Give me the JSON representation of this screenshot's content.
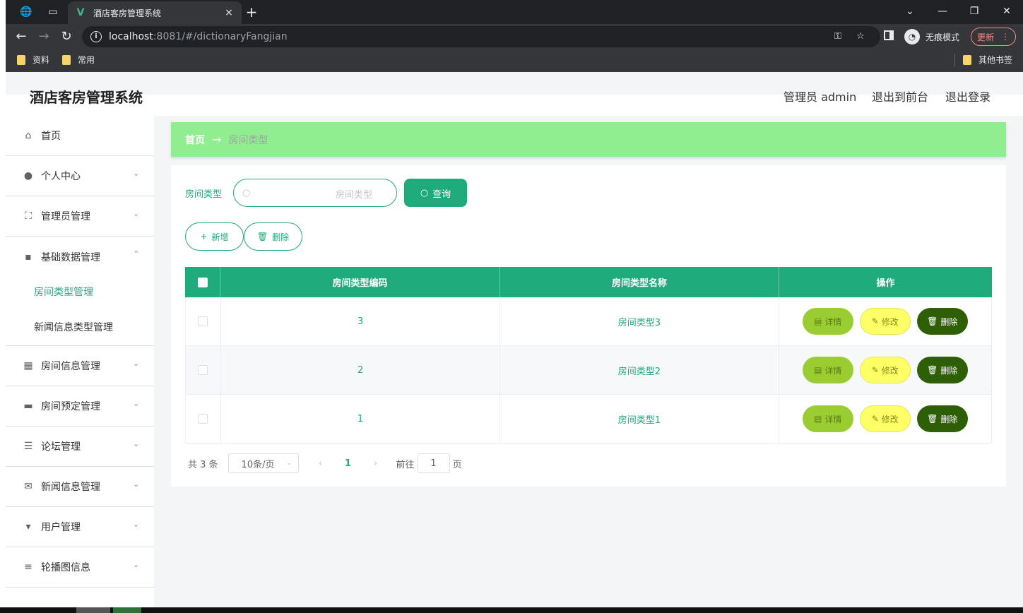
{
  "browser": {
    "tab_title": "酒店客房管理系统",
    "tab_close": "×",
    "new_tab": "+",
    "url_host": "localhost",
    "url_rest": ":8081/#/dictionaryFangjian",
    "incognito_label": "无痕模式",
    "update_label": "更新",
    "bookmarks": [
      "资料",
      "常用"
    ],
    "other_bookmarks": "其他书签"
  },
  "header": {
    "title": "酒店客房管理系统",
    "admin_label": "管理员 admin",
    "to_front": "退出到前台",
    "logout": "退出登录"
  },
  "sidebar": {
    "items": [
      {
        "label": "首页",
        "icon": "home-icon",
        "expandable": false
      },
      {
        "label": "个人中心",
        "icon": "user-icon",
        "expandable": true
      },
      {
        "label": "管理员管理",
        "icon": "fullscreen-icon",
        "expandable": true
      },
      {
        "label": "基础数据管理",
        "icon": "chat-icon",
        "expandable": true,
        "expanded": true
      },
      {
        "label": "房间信息管理",
        "icon": "grid-icon",
        "expandable": true
      },
      {
        "label": "房间预定管理",
        "icon": "briefcase-icon",
        "expandable": true
      },
      {
        "label": "论坛管理",
        "icon": "sliders-icon",
        "expandable": true
      },
      {
        "label": "新闻信息管理",
        "icon": "mail-icon",
        "expandable": true
      },
      {
        "label": "用户管理",
        "icon": "brush-icon",
        "expandable": true
      },
      {
        "label": "轮播图信息",
        "icon": "list-icon",
        "expandable": true
      }
    ],
    "submenu": [
      {
        "label": "房间类型管理",
        "active": true
      },
      {
        "label": "新闻信息类型管理",
        "active": false
      }
    ]
  },
  "breadcrumb": {
    "home": "首页",
    "separator": "→",
    "current": "房间类型"
  },
  "search": {
    "label": "房间类型",
    "placeholder": "房间类型",
    "query_button": "查询"
  },
  "actions": {
    "add": "新增",
    "delete": "删除"
  },
  "table": {
    "columns": [
      "房间类型编码",
      "房间类型名称",
      "操作"
    ],
    "rows": [
      {
        "code": "3",
        "name": "房间类型3"
      },
      {
        "code": "2",
        "name": "房间类型2"
      },
      {
        "code": "1",
        "name": "房间类型1"
      }
    ],
    "op_labels": {
      "detail": "详情",
      "edit": "修改",
      "delete": "删除"
    }
  },
  "pager": {
    "total": "共 3 条",
    "page_size": "10条/页",
    "current_page": "1",
    "goto_prefix": "前往",
    "goto_value": "1",
    "goto_suffix": "页"
  },
  "colors": {
    "primary": "#1faa7c",
    "breadcrumb_bg": "#90ee90",
    "detail_btn": "#9acd32",
    "edit_btn": "#ffff66",
    "delete_btn": "#2e5f07"
  }
}
